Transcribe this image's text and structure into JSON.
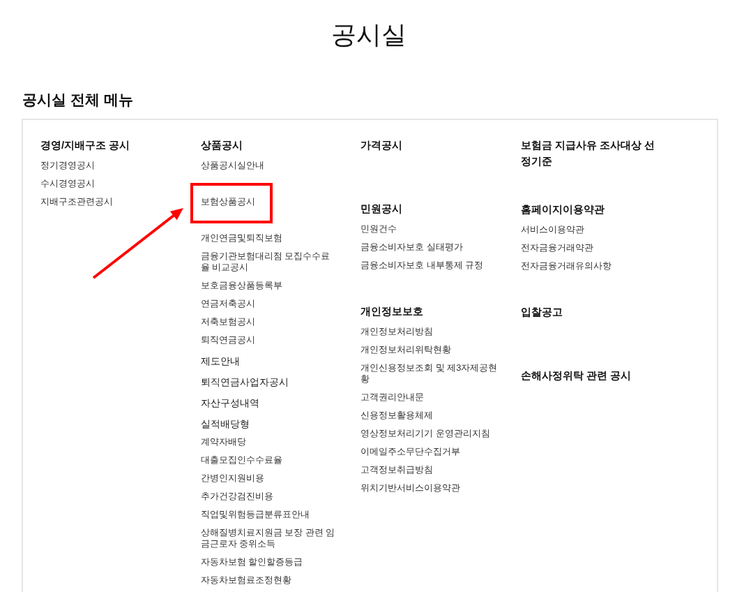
{
  "page": {
    "title": "공시실"
  },
  "menu": {
    "heading": "공시실 전체 메뉴",
    "columns": [
      {
        "sections": [
          {
            "heading": "경영/지배구조 공시",
            "items": [
              {
                "kind": "link",
                "label": "정기경영공시",
                "highlighted": false
              },
              {
                "kind": "link",
                "label": "수시경영공시",
                "highlighted": false
              },
              {
                "kind": "link",
                "label": "지배구조관련공시",
                "highlighted": false
              }
            ]
          }
        ]
      },
      {
        "sections": [
          {
            "heading": "상품공시",
            "items": [
              {
                "kind": "link",
                "label": "상품공시실안내",
                "highlighted": false
              },
              {
                "kind": "link",
                "label": "보험상품공시",
                "highlighted": true
              },
              {
                "kind": "link",
                "label": "개인연금및퇴직보험",
                "highlighted": false
              },
              {
                "kind": "link",
                "label": "금융기관보험대리점 모집수수료율 비교공시",
                "highlighted": false
              },
              {
                "kind": "link",
                "label": "보호금융상품등록부",
                "highlighted": false
              },
              {
                "kind": "link",
                "label": "연금저축공시",
                "highlighted": false
              },
              {
                "kind": "link",
                "label": "저축보험공시",
                "highlighted": false
              },
              {
                "kind": "link",
                "label": "퇴직연금공시",
                "highlighted": false
              },
              {
                "kind": "subheading",
                "label": "제도안내",
                "highlighted": false
              },
              {
                "kind": "subheading",
                "label": "퇴직연금사업자공시",
                "highlighted": false
              },
              {
                "kind": "subheading",
                "label": "자산구성내역",
                "highlighted": false
              },
              {
                "kind": "subheading",
                "label": "실적배당형",
                "highlighted": false
              },
              {
                "kind": "link",
                "label": "계약자배당",
                "highlighted": false
              },
              {
                "kind": "link",
                "label": "대출모집인수수료율",
                "highlighted": false
              },
              {
                "kind": "link",
                "label": "간병인지원비용",
                "highlighted": false
              },
              {
                "kind": "link",
                "label": "추가건강검진비용",
                "highlighted": false
              },
              {
                "kind": "link",
                "label": "직업및위험등급분류표안내",
                "highlighted": false
              },
              {
                "kind": "link",
                "label": "상해질병치료지원금 보장 관련 임금근로자 중위소득",
                "highlighted": false
              },
              {
                "kind": "link",
                "label": "자동차보험 할인할증등급",
                "highlighted": false
              },
              {
                "kind": "link",
                "label": "자동차보험료조정현황",
                "highlighted": false
              }
            ]
          }
        ]
      },
      {
        "sections": [
          {
            "heading": "가격공시"
          },
          {
            "heading": "민원공시",
            "items": [
              {
                "kind": "link",
                "label": "민원건수",
                "highlighted": false
              },
              {
                "kind": "link",
                "label": "금융소비자보호 실태평가",
                "highlighted": false
              },
              {
                "kind": "link",
                "label": "금융소비자보호 내부통제 규정",
                "highlighted": false
              }
            ]
          },
          {
            "heading": "개인정보보호",
            "items": [
              {
                "kind": "link",
                "label": "개인정보처리방침",
                "highlighted": false
              },
              {
                "kind": "link",
                "label": "개인정보처리위탁현황",
                "highlighted": false
              },
              {
                "kind": "link",
                "label": "개인신용정보조회 및 제3자제공현황",
                "highlighted": false
              },
              {
                "kind": "link",
                "label": "고객권리안내문",
                "highlighted": false
              },
              {
                "kind": "link",
                "label": "신용정보활용체제",
                "highlighted": false
              },
              {
                "kind": "link",
                "label": "영상정보처리기기 운영관리지침",
                "highlighted": false
              },
              {
                "kind": "link",
                "label": "이메일주소무단수집거부",
                "highlighted": false
              },
              {
                "kind": "link",
                "label": "고객정보취급방침",
                "highlighted": false
              },
              {
                "kind": "link",
                "label": "위치기반서비스이용약관",
                "highlighted": false
              }
            ]
          }
        ]
      },
      {
        "sections": [
          {
            "heading": "보험금 지급사유 조사대상 선정기준"
          },
          {
            "heading": "홈페이지이용약관",
            "items": [
              {
                "kind": "link",
                "label": "서비스이용약관",
                "highlighted": false
              },
              {
                "kind": "link",
                "label": "전자금융거래약관",
                "highlighted": false
              },
              {
                "kind": "link",
                "label": "전자금융거래유의사항",
                "highlighted": false
              }
            ]
          },
          {
            "heading": "입찰공고"
          },
          {
            "heading": "손해사정위탁 관련 공시"
          }
        ]
      }
    ]
  }
}
